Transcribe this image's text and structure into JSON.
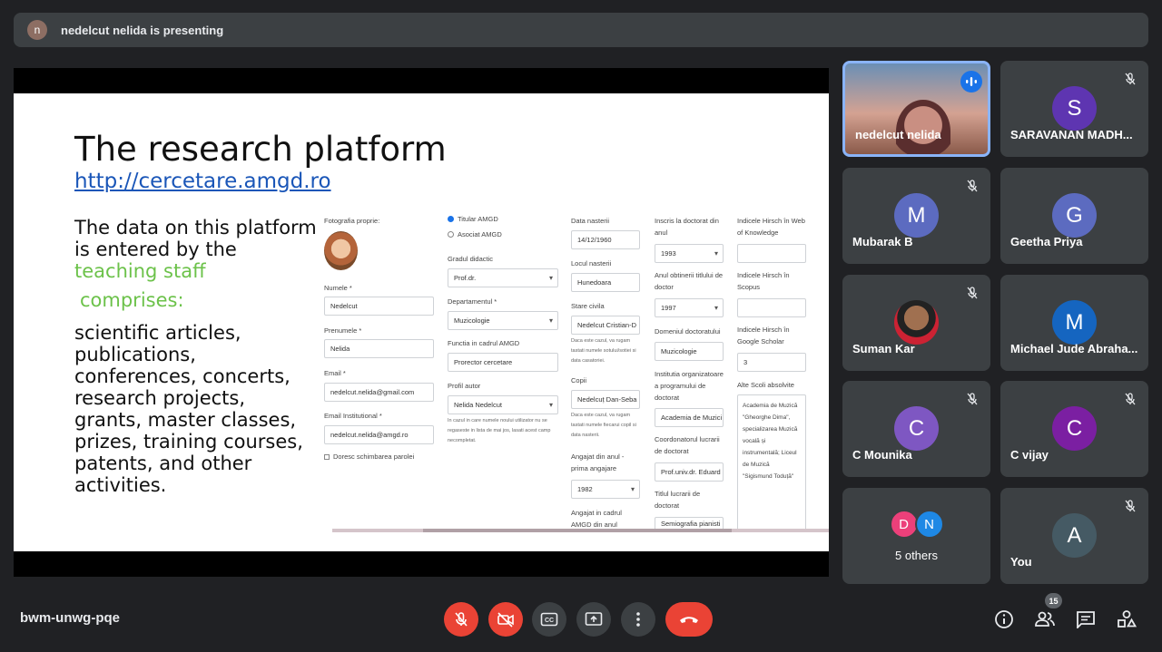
{
  "header": {
    "presenter_initial": "n",
    "presenting_text": "nedelcut nelida is presenting"
  },
  "slide": {
    "title": "The research platform",
    "link": "http://cercetare.amgd.ro",
    "body_line1": "The data on this platform is entered by the ",
    "body_highlight": "teaching staff",
    "body_comprises": "comprises:",
    "body_list": "scientific articles, publications, conferences, concerts, research projects, grants, master classes, prizes, training courses, patents, and other activities."
  },
  "form": {
    "photo_label": "Fotografia proprie:",
    "last_name_label": "Numele *",
    "last_name": "Nedelcut",
    "first_name_label": "Prenumele *",
    "first_name": "Nelida",
    "email_label": "Email *",
    "email": "nedelcut.nelida@gmail.com",
    "email_inst_label": "Email Institutional *",
    "email_inst": "nedelcut.nelida@amgd.ro",
    "change_password": "Doresc schimbarea parolei",
    "radio_titular": "Titular AMGD",
    "radio_asociat": "Asociat AMGD",
    "grade_label": "Gradul didactic",
    "grade": "Prof.dr.",
    "dept_label": "Departamentul *",
    "dept": "Muzicologie",
    "function_label": "Functia in cadrul AMGD",
    "function": "Prorector cercetare",
    "profile_label": "Profil autor",
    "profile": "Nelida Nedelcut",
    "profile_hint": "In cazul in care numele noului utilizator nu se regaseste in lista de mai jos, lasati acest camp necompletat.",
    "birth_date_label": "Data nasterii",
    "birth_date": "14/12/1960",
    "birth_place_label": "Locul nasterii",
    "birth_place": "Hunedoara",
    "civil_label": "Stare civila",
    "civil": "Nedelcut Cristian-D",
    "civil_hint": "Daca este cazul, va rugam tastati numele sotului/sotiei si data casatoriei.",
    "children_label": "Copii",
    "children": "Nedelcuț Dan-Seba",
    "children_hint": "Daca este cazul, va rugam tastati numele fiecarui copil si data nasterii.",
    "employed_label": "Angajat din anul - prima angajare",
    "employed": "1982",
    "employed_amgd_label": "Angajat in cadrul AMGD din anul",
    "phd_year_label": "Inscris la doctorat din anul",
    "phd_year": "1993",
    "phd_title_year_label": "Anul obtinerii titlului de doctor",
    "phd_title_year": "1997",
    "phd_domain_label": "Domeniul doctoratului",
    "phd_domain": "Muzicologie",
    "phd_inst_label": "Institutia organizatoare a programului de doctorat",
    "phd_inst": "Academia de Muzici",
    "coord_label": "Coordonatorul lucrarii de doctorat",
    "coord": "Prof.univ.dr. Eduard",
    "thesis_label": "Titlul lucrarii de doctorat",
    "thesis": "Semiografia pianisti",
    "hirsch_wok_label": "Indicele Hirsch în Web of Knowledge",
    "hirsch_scopus_label": "Indicele Hirsch în Scopus",
    "hirsch_gs_label": "Indicele Hirsch în Google Scholar",
    "hirsch_gs": "3",
    "schools_label": "Alte Scoli absolvite",
    "schools": "Academia de Muzică \"Gheorghe Dima\", specializarea Muzică vocală și instrumentală; Liceul de Muzică \"Sigismund Toduță\""
  },
  "participants": [
    {
      "name": "nedelcut nelida"
    },
    {
      "name": "SARAVANAN MADH...",
      "initial": "S",
      "color": "#5e35b1"
    },
    {
      "name": "Mubarak B",
      "initial": "M",
      "color": "#5c6bc0"
    },
    {
      "name": "Geetha Priya",
      "initial": "G",
      "color": "#5c6bc0"
    },
    {
      "name": "Suman Kar"
    },
    {
      "name": "Michael Jude Abraha...",
      "initial": "M",
      "color": "#1565c0"
    },
    {
      "name": "C Mounika",
      "initial": "C",
      "color": "#7e57c2"
    },
    {
      "name": "C vijay",
      "initial": "C",
      "color": "#7b1fa2"
    },
    {
      "name": "You",
      "initial": "A",
      "color": "#455a64"
    }
  ],
  "others": {
    "label": "5 others",
    "avatars": [
      {
        "initial": "D",
        "color": "#ec407a"
      },
      {
        "initial": "N",
        "color": "#1e88e5"
      }
    ]
  },
  "footer": {
    "meeting_code": "bwm-unwg-pqe",
    "people_count": "15"
  }
}
